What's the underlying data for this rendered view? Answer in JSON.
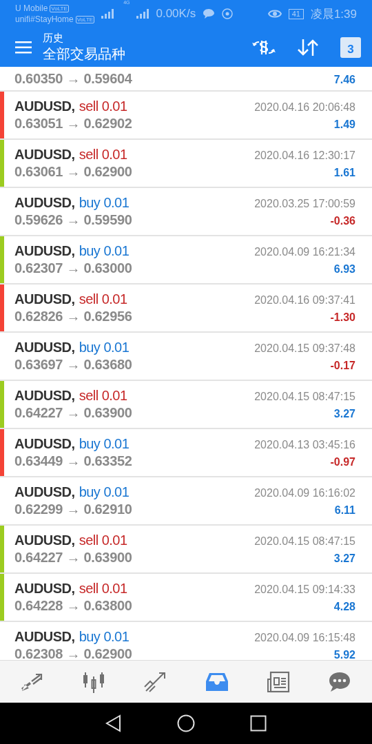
{
  "status_bar": {
    "carrier_1": "U Mobile",
    "carrier_2": "unifi#StayHome",
    "volte_badges": [
      "VoLTE",
      "VoLTE"
    ],
    "network": "4G",
    "speed": "0.00K/s",
    "battery": "41",
    "time": "凌晨1:39"
  },
  "header": {
    "title": "历史",
    "subtitle": "全部交易品种",
    "calendar_day": "3"
  },
  "rows": [
    {
      "kind": "partial",
      "prices": "0.60350 → 0.59604",
      "profit": "7.46",
      "loss": false
    },
    {
      "kind": "full",
      "color": "#f44336",
      "symbol": "AUDUSD,",
      "type": "sell 0.01",
      "sell": true,
      "time": "2020.04.16 20:06:48",
      "prices": "0.63051 → 0.62902",
      "profit": "1.49",
      "loss": false
    },
    {
      "kind": "full",
      "color": "#9ccc20",
      "symbol": "AUDUSD,",
      "type": "sell 0.01",
      "sell": true,
      "time": "2020.04.16 12:30:17",
      "prices": "0.63061 → 0.62900",
      "profit": "1.61",
      "loss": false
    },
    {
      "kind": "full",
      "symbol": "AUDUSD,",
      "type": "buy 0.01",
      "sell": false,
      "time": "2020.03.25 17:00:59",
      "prices": "0.59626 → 0.59590",
      "profit": "-0.36",
      "loss": true
    },
    {
      "kind": "full",
      "color": "#9ccc20",
      "symbol": "AUDUSD,",
      "type": "buy 0.01",
      "sell": false,
      "time": "2020.04.09 16:21:34",
      "prices": "0.62307 → 0.63000",
      "profit": "6.93",
      "loss": false
    },
    {
      "kind": "full",
      "color": "#f44336",
      "symbol": "AUDUSD,",
      "type": "sell 0.01",
      "sell": true,
      "time": "2020.04.16 09:37:41",
      "prices": "0.62826 → 0.62956",
      "profit": "-1.30",
      "loss": true
    },
    {
      "kind": "full",
      "symbol": "AUDUSD,",
      "type": "buy 0.01",
      "sell": false,
      "time": "2020.04.15 09:37:48",
      "prices": "0.63697 → 0.63680",
      "profit": "-0.17",
      "loss": true
    },
    {
      "kind": "full",
      "color": "#9ccc20",
      "symbol": "AUDUSD,",
      "type": "sell 0.01",
      "sell": true,
      "time": "2020.04.15 08:47:15",
      "prices": "0.64227 → 0.63900",
      "profit": "3.27",
      "loss": false
    },
    {
      "kind": "full",
      "color": "#f44336",
      "symbol": "AUDUSD,",
      "type": "buy 0.01",
      "sell": false,
      "time": "2020.04.13 03:45:16",
      "prices": "0.63449 → 0.63352",
      "profit": "-0.97",
      "loss": true
    },
    {
      "kind": "full",
      "symbol": "AUDUSD,",
      "type": "buy 0.01",
      "sell": false,
      "time": "2020.04.09 16:16:02",
      "prices": "0.62299 → 0.62910",
      "profit": "6.11",
      "loss": false
    },
    {
      "kind": "full",
      "color": "#9ccc20",
      "symbol": "AUDUSD,",
      "type": "sell 0.01",
      "sell": true,
      "time": "2020.04.15 08:47:15",
      "prices": "0.64227 → 0.63900",
      "profit": "3.27",
      "loss": false
    },
    {
      "kind": "full",
      "color": "#9ccc20",
      "symbol": "AUDUSD,",
      "type": "sell 0.01",
      "sell": true,
      "time": "2020.04.15 09:14:33",
      "prices": "0.64228 → 0.63800",
      "profit": "4.28",
      "loss": false
    },
    {
      "kind": "full",
      "symbol": "AUDUSD,",
      "type": "buy 0.01",
      "sell": false,
      "time": "2020.04.09 16:15:48",
      "prices": "0.62308 → 0.62900",
      "profit": "5.92",
      "loss": false
    }
  ],
  "bottom_nav": [
    {
      "kind": "trade",
      "selected": false
    },
    {
      "kind": "quotes",
      "selected": false
    },
    {
      "kind": "chart",
      "selected": false
    },
    {
      "kind": "history",
      "selected": true
    },
    {
      "kind": "news",
      "selected": false
    },
    {
      "kind": "chat",
      "selected": false
    }
  ]
}
